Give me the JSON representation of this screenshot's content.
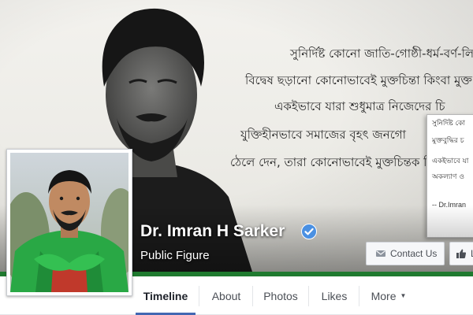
{
  "cover": {
    "quote_lines": [
      "সুনির্দিষ্ট কোনো জাতি-গোষ্ঠী-ধর্ম-বর্ণ-লি",
      "বিদ্বেষ ছড়ানো কোনোভাবেই মুক্তচিন্তা কিংবা মুক্ত",
      "একইভাবে যারা শুধুমাত্র নিজেদের চি",
      "যুক্তিহীনভাবে সমাজের বৃহৎ জনগো",
      "ঠেলে দেন, তারা কোনোভাবেই মুক্তচিন্তক বি"
    ],
    "popup": {
      "lines": [
        "সুনির্দিষ্ট কো",
        "মুক্তবুদ্ধির চ"
      ],
      "lines_b": [
        "একইভাবে যা",
        "অকল্যাণ ও"
      ],
      "signature": "-- Dr.Imran"
    }
  },
  "profile": {
    "name": "Dr. Imran H Sarker",
    "category": "Public Figure",
    "verified_icon": "verified-badge-icon"
  },
  "actions": {
    "contact_label": "Contact Us",
    "like_label": "L"
  },
  "nav": {
    "tabs": [
      {
        "label": "Timeline"
      },
      {
        "label": "About"
      },
      {
        "label": "Photos"
      },
      {
        "label": "Likes"
      },
      {
        "label": "More"
      }
    ],
    "more_caret": "▼"
  },
  "colors": {
    "accent": "#4267b2",
    "verified": "#4a90e2",
    "band": "#1f7a2f"
  }
}
